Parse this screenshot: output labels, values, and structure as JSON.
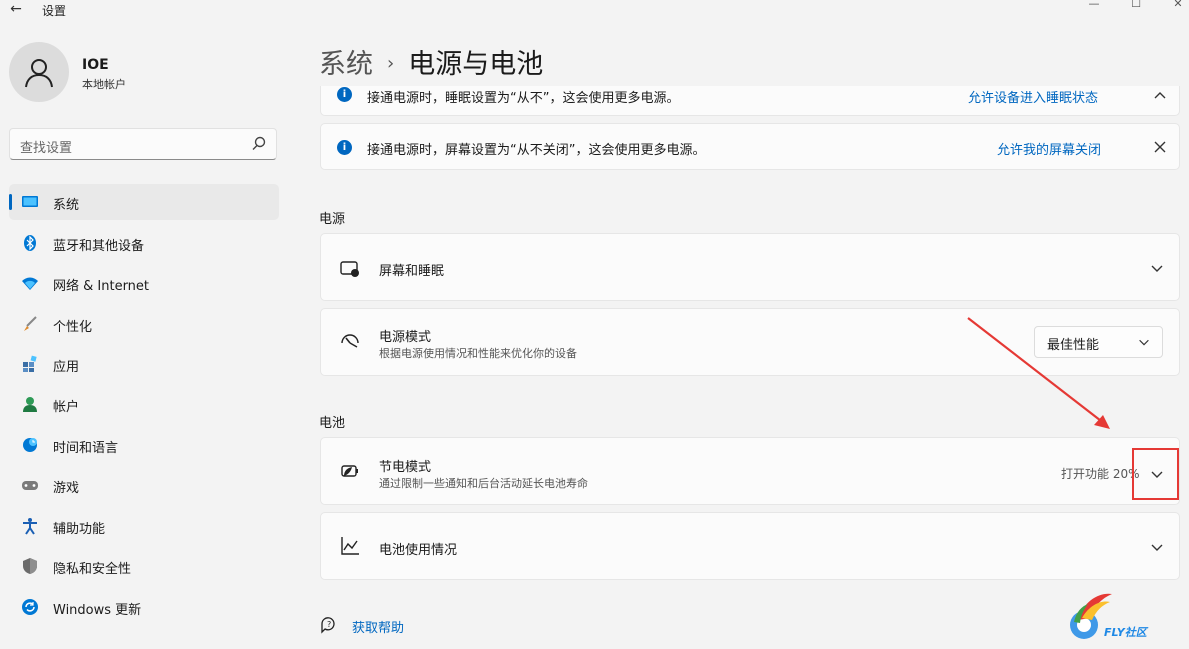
{
  "window": {
    "title": "设置",
    "back_glyph": "←",
    "min_glyph": "—",
    "max_glyph": "☐",
    "close_glyph": "✕"
  },
  "user": {
    "name": "IOE",
    "account_type": "本地帐户"
  },
  "search": {
    "placeholder": "查找设置"
  },
  "sidebar": {
    "items": [
      {
        "label": "系统",
        "icon": "monitor-icon",
        "active": true
      },
      {
        "label": "蓝牙和其他设备",
        "icon": "bluetooth-icon"
      },
      {
        "label": "网络 & Internet",
        "icon": "wifi-icon"
      },
      {
        "label": "个性化",
        "icon": "brush-icon"
      },
      {
        "label": "应用",
        "icon": "apps-icon"
      },
      {
        "label": "帐户",
        "icon": "person-icon"
      },
      {
        "label": "时间和语言",
        "icon": "globe-clock-icon"
      },
      {
        "label": "游戏",
        "icon": "gamepad-icon"
      },
      {
        "label": "辅助功能",
        "icon": "accessibility-icon"
      },
      {
        "label": "隐私和安全性",
        "icon": "shield-icon"
      },
      {
        "label": "Windows 更新",
        "icon": "update-icon"
      }
    ]
  },
  "header": {
    "parent": "系统",
    "separator": "›",
    "current": "电源与电池"
  },
  "notices": [
    {
      "text": "接通电源时，睡眠设置为“从不”，这会使用更多电源。",
      "action": "允许设备进入睡眠状态"
    },
    {
      "text": "接通电源时，屏幕设置为“从不关闭”，这会使用更多电源。",
      "action": "允许我的屏幕关闭"
    }
  ],
  "power_section": {
    "title": "电源",
    "screen_sleep": {
      "title": "屏幕和睡眠"
    },
    "power_mode": {
      "title": "电源模式",
      "subtitle": "根据电源使用情况和性能来优化你的设备",
      "value": "最佳性能"
    }
  },
  "battery_section": {
    "title": "电池",
    "saver": {
      "title": "节电模式",
      "subtitle": "通过限制一些通知和后台活动延长电池寿命",
      "status": "打开功能 20%"
    },
    "usage": {
      "title": "电池使用情况"
    }
  },
  "help": {
    "label": "获取帮助"
  },
  "colors": {
    "accent": "#0067c0",
    "annotation_red": "#e53935"
  }
}
